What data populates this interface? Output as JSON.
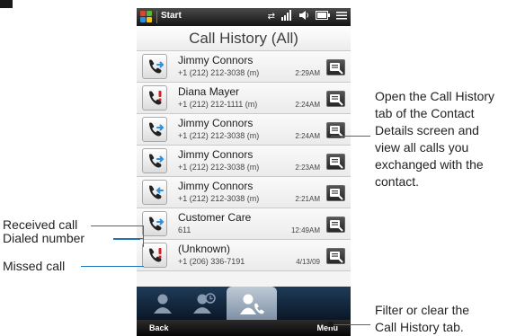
{
  "status_bar": {
    "app_name": "Start",
    "icons": [
      "windows-logo",
      "sync-arrows-icon",
      "signal-icon",
      "volume-icon",
      "battery-icon",
      "connectivity-icon"
    ]
  },
  "screen_title": "Call History (All)",
  "calls": [
    {
      "name": "Jimmy Connors",
      "detail": "+1 (212) 212-3038 (m)",
      "time": "2:29AM",
      "type": "dialed"
    },
    {
      "name": "Diana Mayer",
      "detail": "+1 (212) 212-1111 (m)",
      "time": "2:24AM",
      "type": "missed"
    },
    {
      "name": "Jimmy Connors",
      "detail": "+1 (212) 212-3038 (m)",
      "time": "2:24AM",
      "type": "dialed"
    },
    {
      "name": "Jimmy Connors",
      "detail": "+1 (212) 212-3038 (m)",
      "time": "2:23AM",
      "type": "dialed"
    },
    {
      "name": "Jimmy Connors",
      "detail": "+1 (212) 212-3038 (m)",
      "time": "2:21AM",
      "type": "received"
    },
    {
      "name": "Customer Care",
      "detail": "611",
      "time": "12:49AM",
      "type": "dialed"
    },
    {
      "name": "(Unknown)",
      "detail": "+1 (206) 336-7191",
      "time": "4/13/09",
      "type": "missed"
    }
  ],
  "tabs": [
    {
      "icon": "contacts-icon",
      "active": false
    },
    {
      "icon": "contact-updates-icon",
      "active": false
    },
    {
      "icon": "call-history-icon",
      "active": true
    }
  ],
  "softkeys": {
    "left": "Back",
    "right": "Menu"
  },
  "annotations": {
    "received_call": "Received call",
    "dialed_number": "Dialed number",
    "missed_call": "Missed call",
    "details_lines": [
      "Open the Call History",
      "tab of the Contact",
      "Details screen and",
      "view all calls you",
      "exchanged with the",
      "contact."
    ],
    "menu_lines": [
      "Filter or clear the",
      "Call History tab."
    ]
  },
  "colors": {
    "leader_line": "#1e73b9",
    "tabbar": "#132a42",
    "received_arrow": "#2f8fd8",
    "dialed_arrow": "#2f8fd8",
    "missed_mark": "#d32020"
  }
}
